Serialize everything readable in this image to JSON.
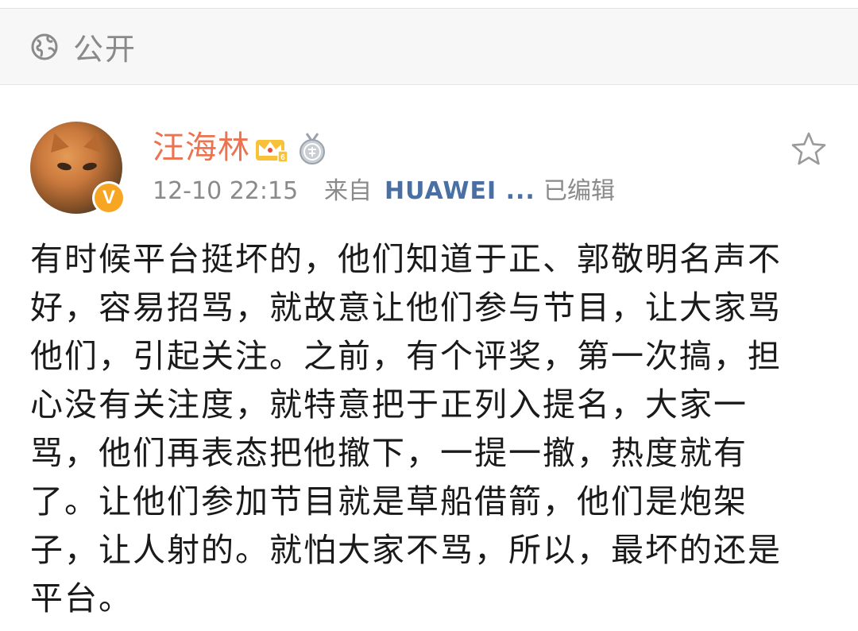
{
  "visibility": {
    "icon": "globe-icon",
    "label": "公开"
  },
  "post": {
    "author": {
      "name": "汪海林",
      "name_color": "#eb7350",
      "avatar": "cat-avatar",
      "verified_badge": "V",
      "verified_color": "#f6a623",
      "badges": [
        "crown-icon",
        "medal-icon"
      ]
    },
    "meta": {
      "time": "12-10 22:15",
      "from_label": "来自",
      "source": "HUAWEI ...",
      "source_color": "#4a6fa5",
      "edited": "已编辑"
    },
    "favorite_icon": "star-icon",
    "text_lines": [
      "有时候平台挺坏的，他们知道于正、郭敬明名声不",
      "好，容易招骂，就故意让他们参与节目，让大家骂",
      "他们，引起关注。之前，有个评奖，第一次搞，担",
      "心没有关注度，就特意把于正列入提名，大家一",
      "骂，他们再表态把他撤下，一提一撤，热度就有",
      "了。让他们参加节目就是草船借箭，他们是炮架",
      "子，让人射的。就怕大家不骂，所以，最坏的还是",
      "平台。"
    ]
  }
}
